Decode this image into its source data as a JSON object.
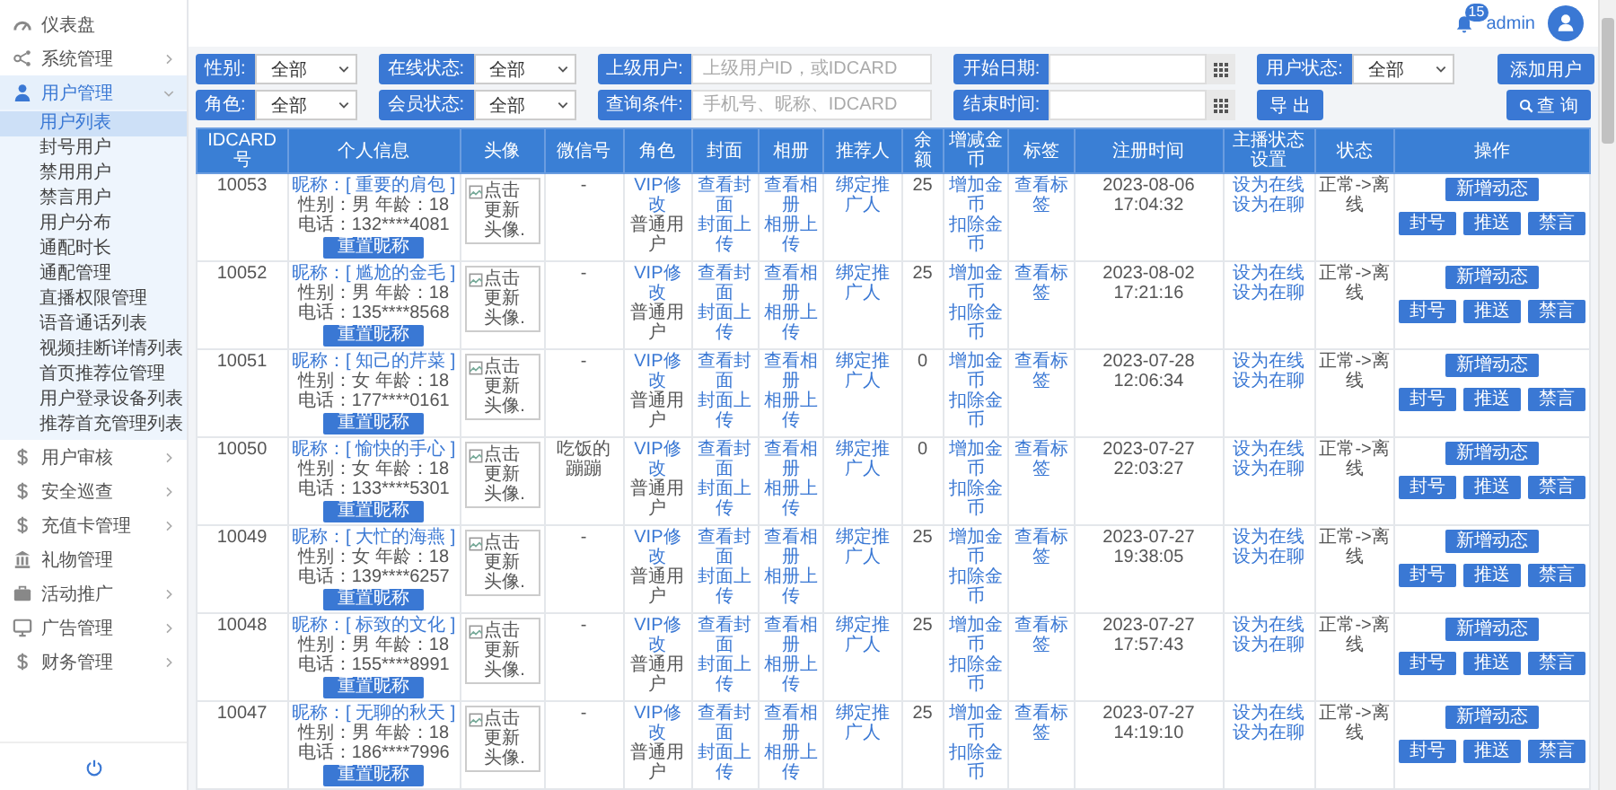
{
  "sidebar": {
    "items": [
      {
        "label": "仪表盘",
        "selected": false
      },
      {
        "label": "系统管理",
        "selected": false,
        "expanded": false
      },
      {
        "label": "用户管理",
        "selected": true,
        "expanded": true,
        "children": [
          {
            "label": "用户列表",
            "selected": true
          },
          {
            "label": "封号用户",
            "selected": false
          },
          {
            "label": "禁用用户",
            "selected": false
          },
          {
            "label": "禁言用户",
            "selected": false
          },
          {
            "label": "用户分布",
            "selected": false
          },
          {
            "label": "通配时长",
            "selected": false
          },
          {
            "label": "通配管理",
            "selected": false
          },
          {
            "label": "直播权限管理",
            "selected": false
          },
          {
            "label": "语音通话列表",
            "selected": false
          },
          {
            "label": "视频挂断详情列表",
            "selected": false
          },
          {
            "label": "首页推荐位管理",
            "selected": false
          },
          {
            "label": "用户登录设备列表",
            "selected": false
          },
          {
            "label": "推荐首充管理列表",
            "selected": false
          }
        ]
      },
      {
        "label": "用户审核",
        "selected": false,
        "expanded": false
      },
      {
        "label": "安全巡查",
        "selected": false,
        "expanded": false
      },
      {
        "label": "充值卡管理",
        "selected": false,
        "expanded": false
      },
      {
        "label": "礼物管理",
        "selected": false
      },
      {
        "label": "活动推广",
        "selected": false,
        "expanded": false
      },
      {
        "label": "广告管理",
        "selected": false,
        "expanded": false
      },
      {
        "label": "财务管理",
        "selected": false,
        "expanded": false
      }
    ]
  },
  "header": {
    "notifications": "15",
    "user": "admin"
  },
  "filters": [
    {
      "fields": [
        {
          "kind": "select",
          "label": "性别:",
          "value": "全部"
        },
        {
          "kind": "select",
          "label": "在线状态:",
          "value": "全部"
        },
        {
          "kind": "text",
          "label": "上级用户:",
          "placeholder": "上级用户ID，或IDCARD"
        },
        {
          "kind": "date",
          "label": "开始日期:"
        },
        {
          "kind": "select",
          "label": "用户状态:",
          "value": "全部"
        }
      ],
      "actions": [
        {
          "kind": "plain",
          "label": "添加用户"
        }
      ]
    },
    {
      "fields": [
        {
          "kind": "select",
          "label": "角色:",
          "value": "全部"
        },
        {
          "kind": "select",
          "label": "会员状态:",
          "value": "全部"
        },
        {
          "kind": "text",
          "label": "查询条件:",
          "placeholder": "手机号、昵称、IDCARD"
        },
        {
          "kind": "date",
          "label": "结束时间:"
        },
        {
          "kind": "button",
          "label": "导 出"
        }
      ],
      "actions": [
        {
          "kind": "search",
          "label": "查 询"
        }
      ]
    }
  ],
  "table": {
    "columns": [
      "IDCARD号",
      "个人信息",
      "头像",
      "微信号",
      "角色",
      "封面",
      "相册",
      "推荐人",
      "余额",
      "增减金币",
      "标签",
      "注册时间",
      "主播状态设置",
      "状态",
      "操作"
    ],
    "rows": [
      {
        "idcard": "10053",
        "nickname": "昵称：[ 重要的肩包 ]",
        "gender_age": "性别：男  年龄：18",
        "phone": "电话：132****4081",
        "reset": "重置昵称",
        "avatar_alt": "点击更新头像.",
        "wechat": "-",
        "role_link": "VIP修改",
        "role": "普通用户",
        "cover": [
          "查看封面",
          "封面上传"
        ],
        "album": [
          "查看相册",
          "相册上传"
        ],
        "referrer": "绑定推广人",
        "balance": "25",
        "coins": [
          "增加金币",
          "扣除金币"
        ],
        "tag": "查看标签",
        "registered": "2023-08-06 17:04:32",
        "host": [
          "设为在线",
          "设为在聊"
        ],
        "status": "正常->离线",
        "actions": [
          "新增动态",
          "封号",
          "推送",
          "禁言"
        ]
      },
      {
        "idcard": "10052",
        "nickname": "昵称：[ 尴尬的金毛 ]",
        "gender_age": "性别：男  年龄：18",
        "phone": "电话：135****8568",
        "reset": "重置昵称",
        "avatar_alt": "点击更新头像.",
        "wechat": "-",
        "role_link": "VIP修改",
        "role": "普通用户",
        "cover": [
          "查看封面",
          "封面上传"
        ],
        "album": [
          "查看相册",
          "相册上传"
        ],
        "referrer": "绑定推广人",
        "balance": "25",
        "coins": [
          "增加金币",
          "扣除金币"
        ],
        "tag": "查看标签",
        "registered": "2023-08-02 17:21:16",
        "host": [
          "设为在线",
          "设为在聊"
        ],
        "status": "正常->离线",
        "actions": [
          "新增动态",
          "封号",
          "推送",
          "禁言"
        ]
      },
      {
        "idcard": "10051",
        "nickname": "昵称：[ 知己的芹菜 ]",
        "gender_age": "性别：女  年龄：18",
        "phone": "电话：177****0161",
        "reset": "重置昵称",
        "avatar_alt": "点击更新头像.",
        "wechat": "-",
        "role_link": "VIP修改",
        "role": "普通用户",
        "cover": [
          "查看封面",
          "封面上传"
        ],
        "album": [
          "查看相册",
          "相册上传"
        ],
        "referrer": "绑定推广人",
        "balance": "0",
        "coins": [
          "增加金币",
          "扣除金币"
        ],
        "tag": "查看标签",
        "registered": "2023-07-28 12:06:34",
        "host": [
          "设为在线",
          "设为在聊"
        ],
        "status": "正常->离线",
        "actions": [
          "新增动态",
          "封号",
          "推送",
          "禁言"
        ]
      },
      {
        "idcard": "10050",
        "nickname": "昵称：[ 愉快的手心 ]",
        "gender_age": "性别：女  年龄：18",
        "phone": "电话：133****5301",
        "reset": "重置昵称",
        "avatar_alt": "点击更新头像.",
        "wechat": "吃饭的蹦蹦",
        "role_link": "VIP修改",
        "role": "普通用户",
        "cover": [
          "查看封面",
          "封面上传"
        ],
        "album": [
          "查看相册",
          "相册上传"
        ],
        "referrer": "绑定推广人",
        "balance": "0",
        "coins": [
          "增加金币",
          "扣除金币"
        ],
        "tag": "查看标签",
        "registered": "2023-07-27 22:03:27",
        "host": [
          "设为在线",
          "设为在聊"
        ],
        "status": "正常->离线",
        "actions": [
          "新增动态",
          "封号",
          "推送",
          "禁言"
        ]
      },
      {
        "idcard": "10049",
        "nickname": "昵称：[ 大忙的海燕 ]",
        "gender_age": "性别：女  年龄：18",
        "phone": "电话：139****6257",
        "reset": "重置昵称",
        "avatar_alt": "点击更新头像.",
        "wechat": "-",
        "role_link": "VIP修改",
        "role": "普通用户",
        "cover": [
          "查看封面",
          "封面上传"
        ],
        "album": [
          "查看相册",
          "相册上传"
        ],
        "referrer": "绑定推广人",
        "balance": "25",
        "coins": [
          "增加金币",
          "扣除金币"
        ],
        "tag": "查看标签",
        "registered": "2023-07-27 19:38:05",
        "host": [
          "设为在线",
          "设为在聊"
        ],
        "status": "正常->离线",
        "actions": [
          "新增动态",
          "封号",
          "推送",
          "禁言"
        ]
      },
      {
        "idcard": "10048",
        "nickname": "昵称：[ 标致的文化 ]",
        "gender_age": "性别：男  年龄：18",
        "phone": "电话：155****8991",
        "reset": "重置昵称",
        "avatar_alt": "点击更新头像.",
        "wechat": "-",
        "role_link": "VIP修改",
        "role": "普通用户",
        "cover": [
          "查看封面",
          "封面上传"
        ],
        "album": [
          "查看相册",
          "相册上传"
        ],
        "referrer": "绑定推广人",
        "balance": "25",
        "coins": [
          "增加金币",
          "扣除金币"
        ],
        "tag": "查看标签",
        "registered": "2023-07-27 17:57:43",
        "host": [
          "设为在线",
          "设为在聊"
        ],
        "status": "正常->离线",
        "actions": [
          "新增动态",
          "封号",
          "推送",
          "禁言"
        ]
      },
      {
        "idcard": "10047",
        "nickname": "昵称：[ 无聊的秋天 ]",
        "gender_age": "性别：男  年龄：18",
        "phone": "电话：186****7996",
        "reset": "重置昵称",
        "avatar_alt": "点击更新头像.",
        "wechat": "-",
        "role_link": "VIP修改",
        "role": "普通用户",
        "cover": [
          "查看封面",
          "封面上传"
        ],
        "album": [
          "查看相册",
          "相册上传"
        ],
        "referrer": "绑定推广人",
        "balance": "25",
        "coins": [
          "增加金币",
          "扣除金币"
        ],
        "tag": "查看标签",
        "registered": "2023-07-27 14:19:10",
        "host": [
          "设为在线",
          "设为在聊"
        ],
        "status": "正常->离线",
        "actions": [
          "新增动态",
          "封号",
          "推送",
          "禁言"
        ]
      }
    ]
  }
}
